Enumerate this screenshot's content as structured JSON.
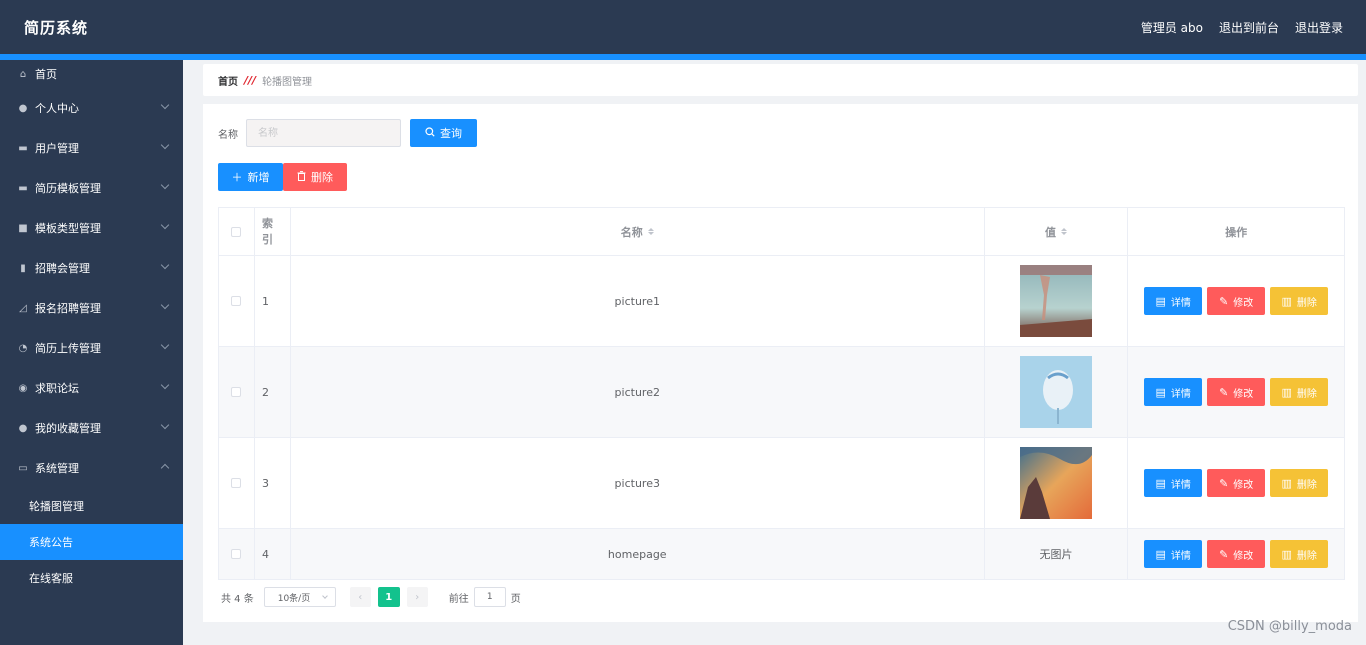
{
  "app": {
    "title": "简历系统"
  },
  "header": {
    "user": "管理员 abo",
    "to_front": "退出到前台",
    "logout": "退出登录"
  },
  "sidebar": {
    "items": [
      {
        "label": "首页",
        "icon": "home-icon",
        "glyph": "⌂"
      },
      {
        "label": "个人中心",
        "icon": "user-icon",
        "glyph": "●"
      },
      {
        "label": "用户管理",
        "icon": "folder-icon",
        "glyph": "▬"
      },
      {
        "label": "简历模板管理",
        "icon": "chat-icon",
        "glyph": "▬"
      },
      {
        "label": "模板类型管理",
        "icon": "briefcase-icon",
        "glyph": "■"
      },
      {
        "label": "招聘会管理",
        "icon": "clipboard-icon",
        "glyph": "▮"
      },
      {
        "label": "报名招聘管理",
        "icon": "chart-icon",
        "glyph": "◿"
      },
      {
        "label": "简历上传管理",
        "icon": "gauge-icon",
        "glyph": "◔"
      },
      {
        "label": "求职论坛",
        "icon": "compass-icon",
        "glyph": "◉"
      },
      {
        "label": "我的收藏管理",
        "icon": "user-icon",
        "glyph": "●"
      },
      {
        "label": "系统管理",
        "icon": "message-icon",
        "glyph": "▭"
      }
    ],
    "sub_items": [
      {
        "label": "轮播图管理"
      },
      {
        "label": "系统公告"
      },
      {
        "label": "在线客服"
      }
    ]
  },
  "breadcrumb": {
    "home": "首页",
    "separator": "///",
    "current": "轮播图管理"
  },
  "search": {
    "label": "名称",
    "placeholder": "名称",
    "query_label": "查询"
  },
  "toolbar": {
    "add_label": "新增",
    "delete_label": "删除"
  },
  "table": {
    "headers": {
      "index": "索引",
      "name": "名称",
      "value": "值",
      "ops": "操作"
    },
    "rows": [
      {
        "index": "1",
        "name": "picture1",
        "value": ""
      },
      {
        "index": "2",
        "name": "picture2",
        "value": ""
      },
      {
        "index": "3",
        "name": "picture3",
        "value": ""
      },
      {
        "index": "4",
        "name": "homepage",
        "value": "无图片"
      }
    ],
    "op_labels": {
      "detail": "详情",
      "edit": "修改",
      "delete": "删除"
    }
  },
  "pagination": {
    "total": "共 4 条",
    "page_size": "10条/页",
    "prev": "‹",
    "current": "1",
    "next": "›",
    "goto_prefix": "前往",
    "goto_value": "1",
    "goto_suffix": "页"
  },
  "watermark": "CSDN @billy_moda"
}
